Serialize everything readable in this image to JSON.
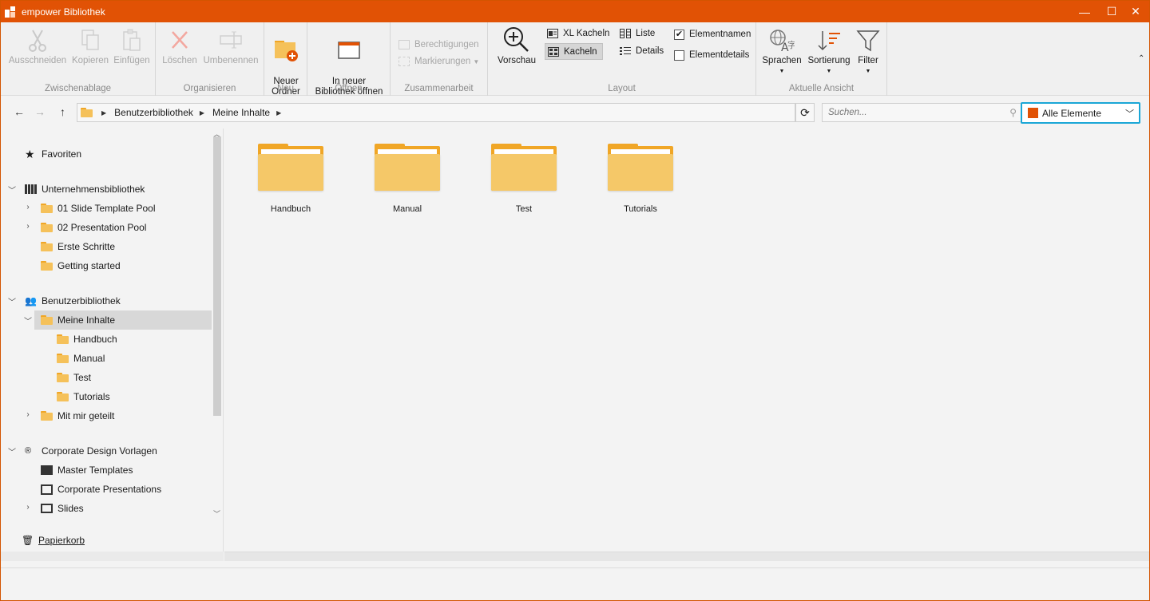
{
  "window": {
    "title": "empower Bibliothek",
    "accent_color": "#e15205",
    "highlight_color": "#1aa6d6",
    "controls": {
      "minimize": "—",
      "maximize": "☐",
      "close": "✕"
    }
  },
  "ribbon": {
    "clipboard": {
      "label": "Zwischenablage",
      "cut": "Ausschneiden",
      "copy": "Kopieren",
      "paste": "Einfügen"
    },
    "organize": {
      "label": "Organisieren",
      "delete": "Löschen",
      "rename": "Umbenennen"
    },
    "new": {
      "label": "Neu",
      "new_folder": "Neuer\nOrdner"
    },
    "open": {
      "label": "Öffnen",
      "open_new": "In neuer\nBibliothek öffnen"
    },
    "collab": {
      "label": "Zusammenarbeit",
      "permissions": "Berechtigungen",
      "markings": "Markierungen"
    },
    "layout": {
      "label": "Layout",
      "preview": "Vorschau",
      "xl_tiles": "XL Kacheln",
      "tiles": "Kacheln",
      "list": "Liste",
      "details": "Details",
      "element_names": "Elementnamen",
      "element_details": "Elementdetails",
      "element_names_checked": true,
      "element_details_checked": false
    },
    "view": {
      "label": "Aktuelle Ansicht",
      "languages": "Sprachen",
      "sorting": "Sortierung",
      "filter": "Filter"
    },
    "collapse_glyph": "⌃"
  },
  "navbar": {
    "breadcrumbs": [
      "Benutzerbibliothek",
      "Meine Inhalte"
    ],
    "search_placeholder": "Suchen...",
    "filter_value": "Alle Elemente"
  },
  "sidebar": {
    "favorites": "Favoriten",
    "company_library": "Unternehmensbibliothek",
    "company_items": [
      "01 Slide Template Pool",
      "02 Presentation Pool",
      "Erste Schritte",
      "Getting started"
    ],
    "user_library": "Benutzerbibliothek",
    "my_content": "Meine Inhalte",
    "my_content_items": [
      "Handbuch",
      "Manual",
      "Test",
      "Tutorials"
    ],
    "shared": "Mit mir geteilt",
    "cd_templates": "Corporate Design Vorlagen",
    "cd_items": [
      "Master Templates",
      "Corporate Presentations",
      "Slides"
    ],
    "trash": "Papierkorb"
  },
  "content": {
    "folders": [
      "Handbuch",
      "Manual",
      "Test",
      "Tutorials"
    ]
  }
}
